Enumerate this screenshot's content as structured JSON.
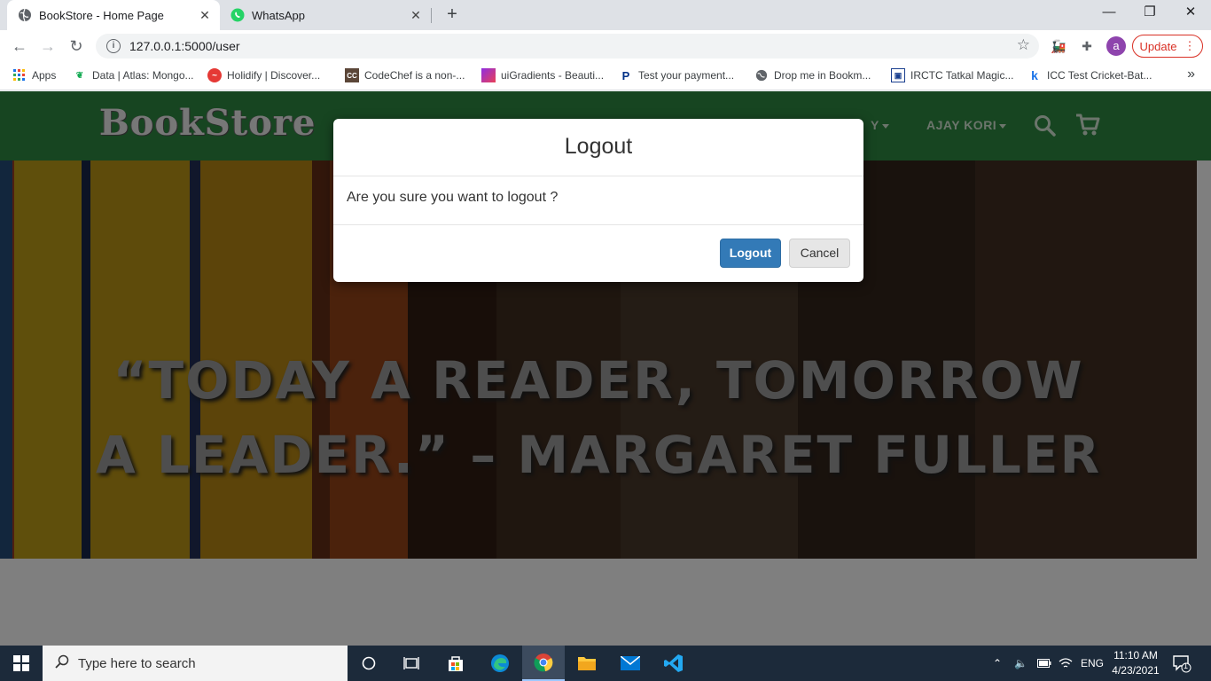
{
  "browser": {
    "tabs": [
      {
        "title": "BookStore - Home Page",
        "active": true
      },
      {
        "title": "WhatsApp",
        "active": false
      }
    ],
    "url": "127.0.0.1:5000/user",
    "profile_initial": "a",
    "update_label": "Update",
    "bookmarks": [
      {
        "label": "Apps"
      },
      {
        "label": "Data | Atlas: Mongo..."
      },
      {
        "label": "Holidify | Discover..."
      },
      {
        "label": "CodeChef is a non-..."
      },
      {
        "label": "uiGradients - Beauti..."
      },
      {
        "label": "Test your payment..."
      },
      {
        "label": "Drop me in Bookm..."
      },
      {
        "label": "IRCTC Tatkal Magic..."
      },
      {
        "label": "ICC Test Cricket-Bat..."
      }
    ]
  },
  "site": {
    "logo": "BookStore",
    "nav_partial": "Y",
    "user_menu": "AJAY KORI",
    "hero_quote": "“TODAY A READER, TOMORROW A LEADER.” – MARGARET FULLER",
    "colors": {
      "nav_bg": "#2e8b43",
      "primary_button": "#337ab7"
    }
  },
  "modal": {
    "title": "Logout",
    "message": "Are you sure you want to logout ?",
    "confirm_label": "Logout",
    "cancel_label": "Cancel"
  },
  "taskbar": {
    "search_placeholder": "Type here to search",
    "language": "ENG",
    "time": "11:10 AM",
    "date": "4/23/2021",
    "notification_count": "1"
  }
}
